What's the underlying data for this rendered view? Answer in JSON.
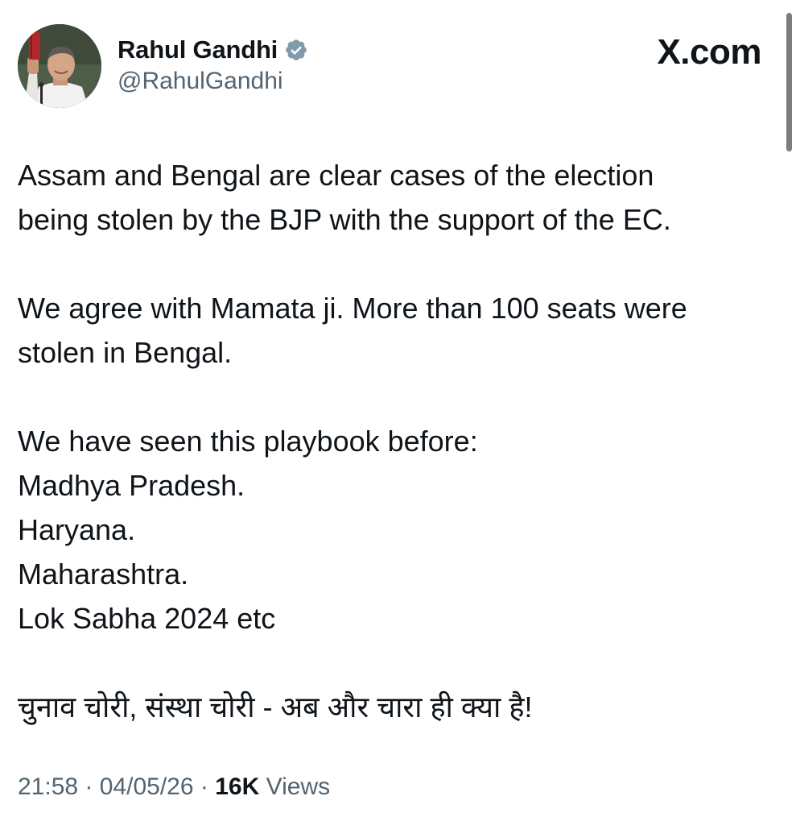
{
  "author": {
    "display_name": "Rahul Gandhi",
    "handle": "@RahulGandhi",
    "verified": true
  },
  "brand": {
    "label": "X.com"
  },
  "tweet": {
    "paragraphs": [
      {
        "lines": [
          "Assam and Bengal are clear cases of the election",
          "being stolen by the BJP with the support of the EC."
        ]
      },
      {
        "lines": [
          "We agree with Mamata ji. More than 100 seats were",
          "stolen in Bengal."
        ]
      },
      {
        "lines": [
          "We have seen this playbook before:",
          "Madhya Pradesh.",
          "Haryana.",
          "Maharashtra.",
          "Lok Sabha 2024 etc"
        ]
      },
      {
        "lines": [
          "चुनाव चोरी, संस्था चोरी - अब और चारा ही क्या है!"
        ]
      }
    ]
  },
  "meta": {
    "time": "21:58",
    "separator": "·",
    "date": "04/05/26",
    "views_count": "16K",
    "views_label": "Views"
  },
  "colors": {
    "text_primary": "#0f1419",
    "text_secondary": "#536471",
    "verified_blue": "#1d9bf0"
  },
  "icons": {
    "verified": "verified-badge-icon",
    "avatar": "profile-photo"
  }
}
